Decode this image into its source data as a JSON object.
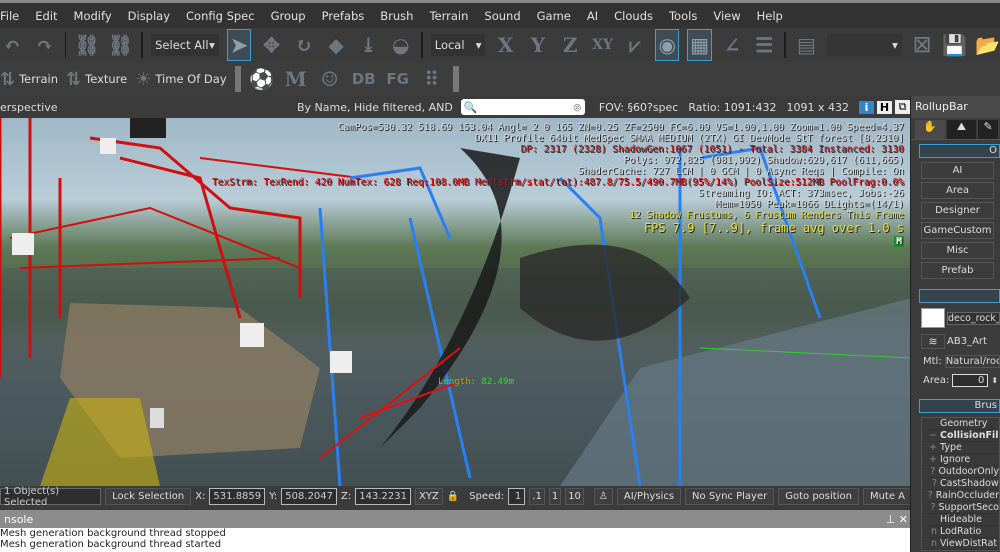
{
  "menu": [
    "File",
    "Edit",
    "Modify",
    "Display",
    "Config Spec",
    "Group",
    "Prefabs",
    "Brush",
    "Terrain",
    "Sound",
    "Game",
    "AI",
    "Clouds",
    "Tools",
    "View",
    "Help"
  ],
  "toolbar1": {
    "select_filter": "Select All",
    "coord_system": "Local",
    "axes": [
      "X",
      "Y",
      "Z",
      "XY"
    ]
  },
  "toolbar2": {
    "terrain": "Terrain",
    "texture": "Texture",
    "time_of_day": "Time Of Day",
    "db": "DB",
    "fg": "FG"
  },
  "viewport_header": {
    "view_name": "erspective",
    "filter_text": "By Name, Hide filtered, AND",
    "search_placeholder": "",
    "fov": "FOV: §60?spec",
    "ratio": "Ratio:  1091:432",
    "resolution": "1091 x 432",
    "info_btn": "i",
    "h_btn": "H"
  },
  "osd": {
    "line1": "CamPos=530.32 518.69 153.04 Angl=  2  0 165 ZN=0.25 ZF=2500 FC=6.09 VS=1.00,1.00 Zoom=1.00 Speed=4.37",
    "line2": "DX11 Profile 64bit MedSpec SMAA MEDIUM (2TX) GI DevMode StT forest [8.2310]",
    "line3": "DP: 2317 (2328) ShadowGen:1067 (1051) - Total: 3384 Instanced: 3130",
    "line4": "Polys: 972,825 (981,992) Shadow:629,617 (611,665)",
    "line5": "ShaderCache: 727 LCM | 0 GCM | 0 Async Reqs | Compile: On",
    "line6": "TexStrm: TexRend: 420 NumTex: 628 Req:108.0MB Mem(strm/stat/tot):487.8/75.5/490.7MB(95%/14%) PoolSize:512MB PoolFrag:0.0%",
    "line7": "Streaming IO: ACT: 373msec, Jobs:-26",
    "line8": "Mem=1050 Peak=1066 DLights=(14/1)",
    "line9": "12 Shadow Frustums, 6 Frustum Renders This Frame",
    "fps": "FPS 7.9 [7..9], frame avg over 1.0 s",
    "m_badge": "M",
    "length_label": "Length: 82.49m"
  },
  "statusbar": {
    "selected": "1 Object(s) Selected",
    "lock_selection": "Lock Selection",
    "x_label": "X:",
    "x": "531.8859",
    "y_label": "Y:",
    "y": "508.2047",
    "z_label": "Z:",
    "z": "143.2231",
    "xyz": "XYZ",
    "speed_label": "Speed:",
    "speed": "1",
    "speed_presets": [
      ".1",
      "1",
      "10"
    ],
    "ai_physics": "AI/Physics",
    "no_sync": "No Sync Player",
    "goto": "Goto position",
    "mute": "Mute A"
  },
  "console": {
    "title": "nsole",
    "lines": [
      "Mesh generation background thread stopped",
      "Mesh generation background thread started"
    ]
  },
  "rollup": {
    "title": "RollupBar",
    "objects_header": "O",
    "buttons": [
      "AI",
      "Area",
      "Designer",
      "GameCustom",
      "Misc",
      "Prefab"
    ],
    "object_name": "deco_rock_f",
    "layer": "AB3_Art",
    "mtl_label": "Mtl:",
    "mtl": "Natural/rock",
    "area_label": "Area:",
    "area": "0",
    "brush_header": "Brus",
    "properties": [
      {
        "m": "",
        "t": "Geometry"
      },
      {
        "m": "−",
        "t": "CollisionFil",
        "bold": true
      },
      {
        "m": "+",
        "t": "Type"
      },
      {
        "m": "+",
        "t": "Ignore"
      },
      {
        "m": "?",
        "t": "OutdoorOnly"
      },
      {
        "m": "?",
        "t": "CastShadow"
      },
      {
        "m": "?",
        "t": "RainOccluder"
      },
      {
        "m": "?",
        "t": "SupportSeco"
      },
      {
        "m": "",
        "t": "Hideable"
      },
      {
        "m": "n",
        "t": "LodRatio"
      },
      {
        "m": "n",
        "t": "ViewDistRat"
      }
    ]
  }
}
